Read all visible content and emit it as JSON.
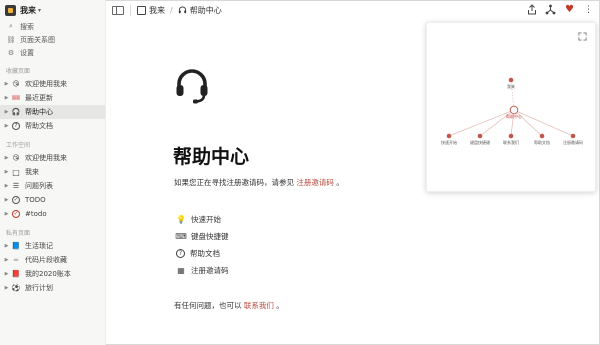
{
  "workspace": {
    "name": "我来",
    "caret": "▾"
  },
  "sidebar": {
    "top_items": [
      {
        "icon": "search-icon",
        "glyph": "⌕",
        "label": "搜索"
      },
      {
        "icon": "link-icon",
        "glyph": "⛓",
        "label": "页面关系图"
      },
      {
        "icon": "gear-icon",
        "glyph": "⚙",
        "label": "设置"
      }
    ],
    "sections": [
      {
        "label": "收藏页面",
        "items": [
          {
            "label": "欢迎使用我来",
            "icon": "emoji-wave-icon",
            "glyph": "😘",
            "active": false
          },
          {
            "label": "最近更新",
            "icon": "ticket-icon",
            "glyph": "🎟",
            "active": false
          },
          {
            "label": "帮助中心",
            "icon": "headset-icon",
            "glyph": "🎧",
            "active": true
          },
          {
            "label": "帮助文档",
            "icon": "help-circle-icon",
            "glyph": "?",
            "active": false
          }
        ]
      },
      {
        "label": "工作空间",
        "items": [
          {
            "label": "欢迎使用我来",
            "icon": "emoji-wave-icon",
            "glyph": "😘",
            "active": false
          },
          {
            "label": "我来",
            "icon": "page-icon",
            "glyph": "□",
            "active": false
          },
          {
            "label": "问题列表",
            "icon": "list-icon",
            "glyph": "☰",
            "active": false
          },
          {
            "label": "TODO",
            "icon": "check-circle-icon",
            "glyph": "✓",
            "active": false
          },
          {
            "label": "#todo",
            "icon": "check-circle-red-icon",
            "glyph": "✓",
            "active": false
          }
        ]
      },
      {
        "label": "私有页面",
        "items": [
          {
            "label": "生活琐记",
            "icon": "book-icon",
            "glyph": "📘",
            "active": false
          },
          {
            "label": "代码片段收藏",
            "icon": "code-icon",
            "glyph": "═",
            "active": false
          },
          {
            "label": "我的2020账本",
            "icon": "ledger-icon",
            "glyph": "📕",
            "active": false
          },
          {
            "label": "旅行计划",
            "icon": "globe-icon",
            "glyph": "⚽",
            "active": false
          }
        ]
      }
    ]
  },
  "topbar": {
    "crumb_root": "我来",
    "crumb_separator": "/",
    "crumb_current": "帮助中心"
  },
  "main": {
    "title": "帮助中心",
    "intro_prefix": "如果您正在寻找注册邀请码，请参见",
    "intro_link": "注册邀请码",
    "intro_suffix": "。",
    "quick_links": [
      {
        "icon": "bulb-icon",
        "glyph": "💡",
        "label": "快速开始"
      },
      {
        "icon": "keyboard-icon",
        "glyph": "⌨",
        "label": "键盘快捷键"
      },
      {
        "icon": "help-circle-icon",
        "glyph": "?",
        "label": "帮助文档"
      },
      {
        "icon": "qr-code-icon",
        "glyph": "▦",
        "label": "注册邀请码"
      }
    ],
    "outro_prefix": "有任何问题，也可以",
    "outro_link": "联系我们",
    "outro_suffix": "。"
  },
  "graph": {
    "root": "我来",
    "center": "帮助中心",
    "children": [
      "快速开始",
      "键盘快捷键",
      "联系我们",
      "帮助文档",
      "注册邀请码"
    ]
  },
  "colors": {
    "accent": "#b74a3a",
    "node": "#c0574a",
    "heart": "#c0392b"
  }
}
